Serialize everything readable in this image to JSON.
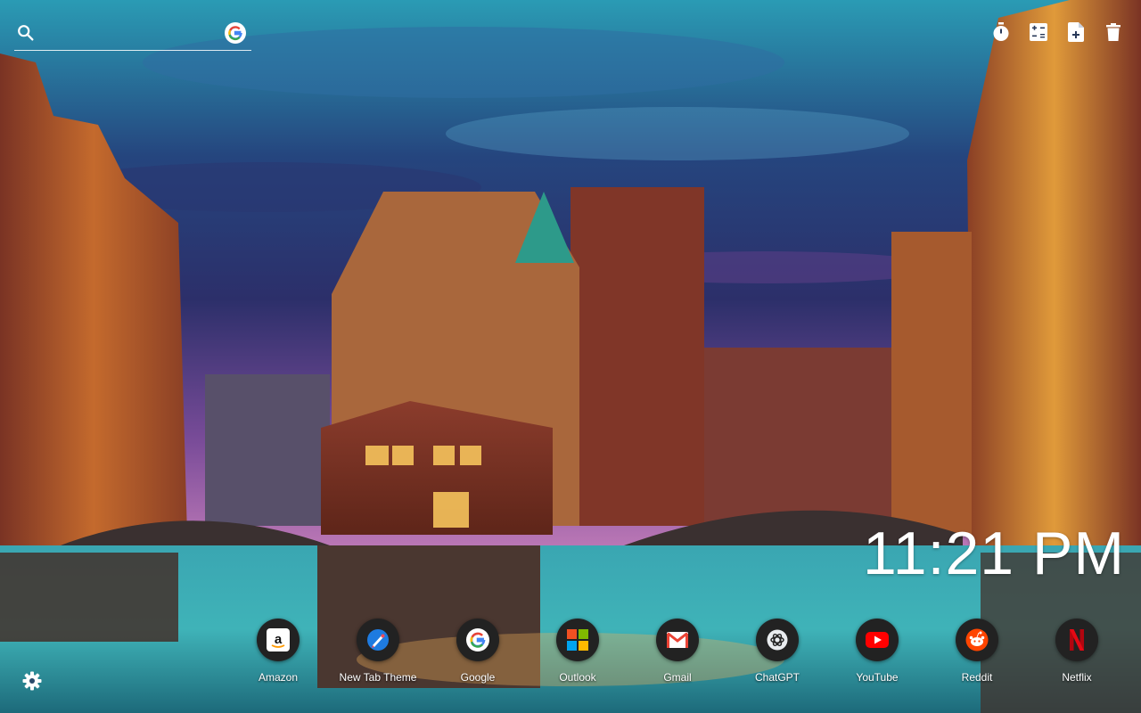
{
  "search": {
    "placeholder": "",
    "value": ""
  },
  "icons": {
    "search": "search-icon",
    "google_search": "google-icon",
    "toolbar": [
      "timer-icon",
      "calculator-icon",
      "notes-icon",
      "trash-icon"
    ],
    "settings": "gear-icon"
  },
  "clock": {
    "time": "11:21 PM"
  },
  "shortcuts": [
    {
      "label": "Amazon",
      "icon": "amazon-icon"
    },
    {
      "label": "New Tab Theme",
      "icon": "new-tab-theme-icon"
    },
    {
      "label": "Google",
      "icon": "google-icon"
    },
    {
      "label": "Outlook",
      "icon": "microsoft-icon"
    },
    {
      "label": "Gmail",
      "icon": "gmail-icon"
    },
    {
      "label": "ChatGPT",
      "icon": "chatgpt-icon"
    },
    {
      "label": "YouTube",
      "icon": "youtube-icon"
    },
    {
      "label": "Reddit",
      "icon": "reddit-icon"
    },
    {
      "label": "Netflix",
      "icon": "netflix-icon"
    }
  ],
  "colors": {
    "text": "#ffffff",
    "google_blue": "#4285F4",
    "google_red": "#EA4335",
    "google_yellow": "#FBBC05",
    "google_green": "#34A853",
    "youtube_red": "#FF0000",
    "reddit_orange": "#FF4500",
    "netflix_red": "#E50914"
  }
}
